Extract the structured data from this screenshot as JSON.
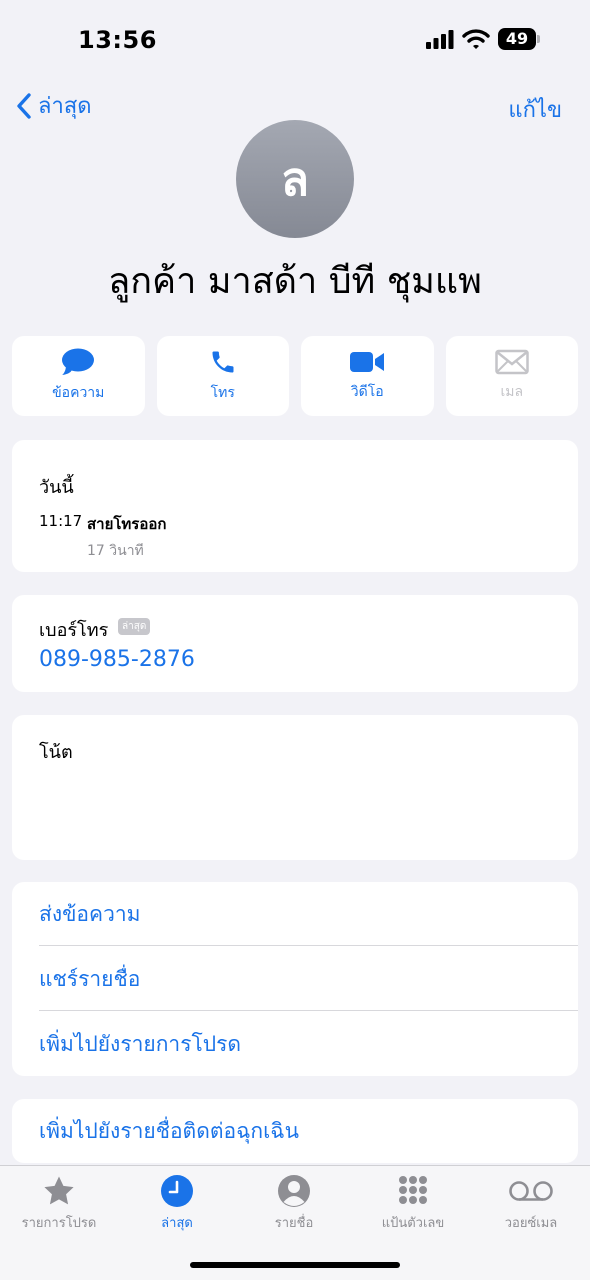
{
  "status_bar": {
    "time": "13:56",
    "battery": "49"
  },
  "nav": {
    "back_label": "ล่าสุด",
    "edit_label": "แก้ไข"
  },
  "contact": {
    "initial": "ล",
    "name": "ลูกค้า มาสด้า บีที ชุมแพ"
  },
  "actions": [
    {
      "label": "ข้อความ",
      "icon": "message-bubble-icon",
      "enabled": true
    },
    {
      "label": "โทร",
      "icon": "phone-icon",
      "enabled": true
    },
    {
      "label": "วิดีโอ",
      "icon": "video-camera-icon",
      "enabled": true
    },
    {
      "label": "เมล",
      "icon": "mail-icon",
      "enabled": false
    }
  ],
  "recent": {
    "title": "วันนี้",
    "time": "11:17",
    "type": "สายโทรออก",
    "duration": "17 วินาที"
  },
  "phone": {
    "label": "เบอร์โทร",
    "badge": "ล่าสุด",
    "number": "089-985-2876"
  },
  "notes": {
    "label": "โน้ต"
  },
  "links": [
    "ส่งข้อความ",
    "แชร์รายชื่อ",
    "เพิ่มไปยังรายการโปรด"
  ],
  "emergency": {
    "label": "เพิ่มไปยังรายชื่อติดต่อฉุกเฉิน"
  },
  "tabs": [
    {
      "label": "รายการโปรด",
      "icon": "star-icon",
      "active": false
    },
    {
      "label": "ล่าสุด",
      "icon": "clock-icon",
      "active": true
    },
    {
      "label": "รายชื่อ",
      "icon": "person-circle-icon",
      "active": false
    },
    {
      "label": "แป้นตัวเลข",
      "icon": "keypad-icon",
      "active": false
    },
    {
      "label": "วอยซ์เมล",
      "icon": "voicemail-icon",
      "active": false
    }
  ],
  "colors": {
    "accent": "#1a73e8",
    "background": "#f2f2f7",
    "inactive": "#8e8e93"
  }
}
